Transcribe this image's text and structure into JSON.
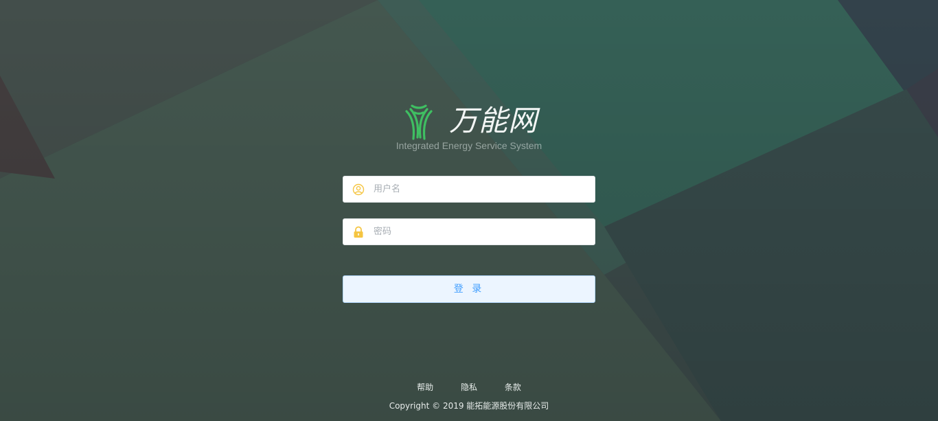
{
  "brand": {
    "name": "万能网",
    "subtitle": "Integrated Energy Service System",
    "logo_icon": "three-arc-leaf-logo"
  },
  "form": {
    "username": {
      "placeholder": "用户名",
      "value": "",
      "icon": "user-circle-icon"
    },
    "password": {
      "placeholder": "密码",
      "value": "",
      "icon": "lock-icon"
    },
    "submit_label": "登 录"
  },
  "footer": {
    "links": [
      "帮助",
      "隐私",
      "条款"
    ],
    "copyright": "Copyright © 2019 能拓能源股份有限公司"
  },
  "colors": {
    "accent": "#409eff",
    "icon_yellow": "#f5c542",
    "logo_green": "#3fbf62"
  }
}
